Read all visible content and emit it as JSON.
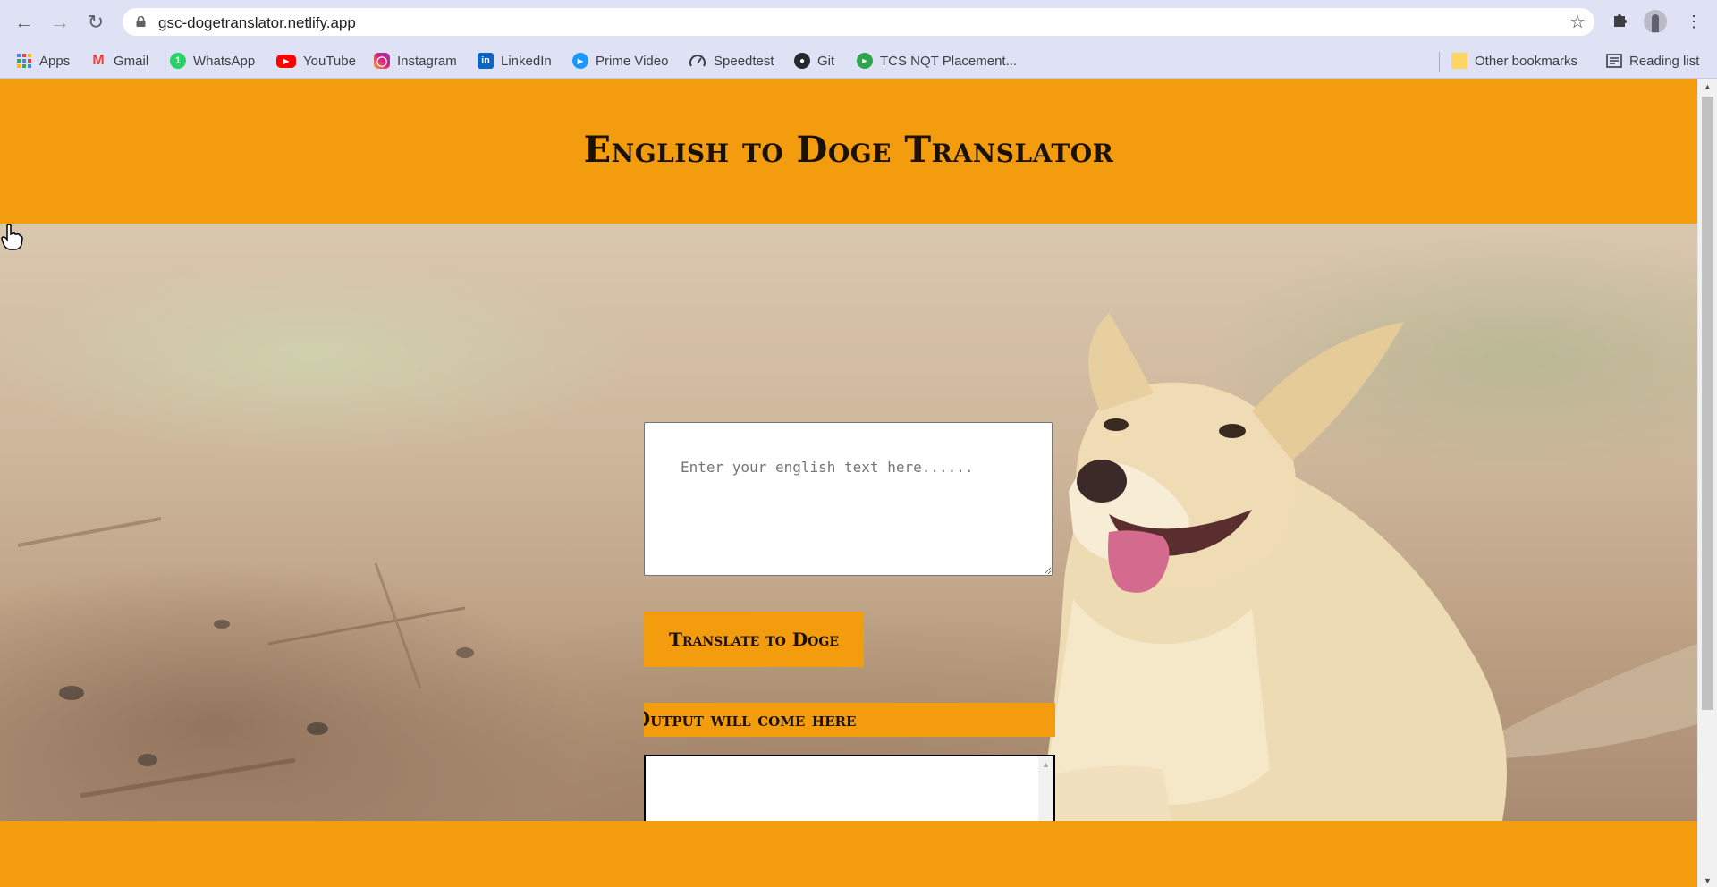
{
  "browser": {
    "url": "gsc-dogetranslator.netlify.app",
    "bookmarks": [
      {
        "label": "Apps",
        "icon": "apps-grid-icon",
        "color": "#4285f4"
      },
      {
        "label": "Gmail",
        "icon": "gmail-icon",
        "color": "#ea4335"
      },
      {
        "label": "WhatsApp",
        "icon": "whatsapp-icon",
        "color": "#25d366"
      },
      {
        "label": "YouTube",
        "icon": "youtube-icon",
        "color": "#ff0000"
      },
      {
        "label": "Instagram",
        "icon": "instagram-icon",
        "color": "#c13584"
      },
      {
        "label": "LinkedIn",
        "icon": "linkedin-icon",
        "color": "#0a66c2"
      },
      {
        "label": "Prime Video",
        "icon": "prime-video-icon",
        "color": "#1a98ff"
      },
      {
        "label": "Speedtest",
        "icon": "speedtest-icon",
        "color": "#3c4043"
      },
      {
        "label": "Git",
        "icon": "github-icon",
        "color": "#24292e"
      },
      {
        "label": "TCS NQT Placement...",
        "icon": "tcs-icon",
        "color": "#2ea44f"
      }
    ],
    "other_bookmarks": "Other bookmarks",
    "reading_list": "Reading list"
  },
  "page": {
    "title": "English to Doge Translator",
    "input_placeholder": "Enter your english text here......",
    "translate_button": "Translate to Doge",
    "output_label": "Output will come here",
    "output_value": ""
  },
  "colors": {
    "accent": "#f39c0d",
    "text_dark": "#1a1208"
  }
}
